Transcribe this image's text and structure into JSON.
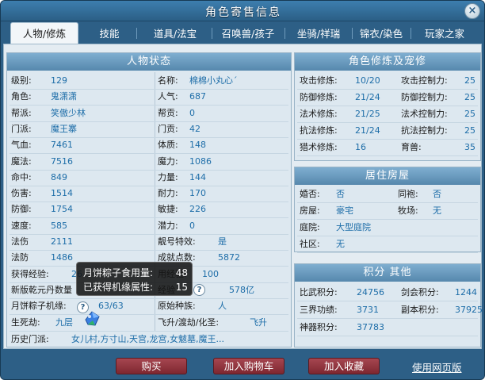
{
  "window": {
    "title": "角色寄售信息",
    "close": "×"
  },
  "tabs": [
    "人物/修炼",
    "技能",
    "道具/法宝",
    "召唤兽/孩子",
    "坐骑/祥瑞",
    "锦衣/染色",
    "玩家之家"
  ],
  "status": {
    "title": "人物状态",
    "left": [
      {
        "k": "级别:",
        "v": "129"
      },
      {
        "k": "角色:",
        "v": "鬼潇潇"
      },
      {
        "k": "帮派:",
        "v": "笑傲少林"
      },
      {
        "k": "门派:",
        "v": "魔王寨"
      },
      {
        "k": "气血:",
        "v": "7461"
      },
      {
        "k": "魔法:",
        "v": "7516"
      },
      {
        "k": "命中:",
        "v": "849"
      },
      {
        "k": "伤害:",
        "v": "1514"
      },
      {
        "k": "防御:",
        "v": "1754"
      },
      {
        "k": "速度:",
        "v": "585"
      },
      {
        "k": "法伤",
        "v": "2111"
      },
      {
        "k": "法防",
        "v": "1486"
      },
      {
        "k": "获得经验:",
        "v": "26"
      },
      {
        "k": "新版乾元丹数量",
        "v": ""
      },
      {
        "k": "月饼粽子机缘:",
        "v": "63/63"
      },
      {
        "k": "生死劫:",
        "v": "九层"
      }
    ],
    "right": [
      {
        "k": "名称:",
        "v": "棉棉小丸心´"
      },
      {
        "k": "人气:",
        "v": "687"
      },
      {
        "k": "帮贡:",
        "v": "0"
      },
      {
        "k": "门贡:",
        "v": "42"
      },
      {
        "k": "体质:",
        "v": "148"
      },
      {
        "k": "魔力:",
        "v": "1086"
      },
      {
        "k": "力量:",
        "v": "144"
      },
      {
        "k": "耐力:",
        "v": "170"
      },
      {
        "k": "敏捷:",
        "v": "226"
      },
      {
        "k": "潜力:",
        "v": "0"
      },
      {
        "k": "靓号特效:",
        "v": "是"
      },
      {
        "k": "成就点数:",
        "v": "5872"
      },
      {
        "k": "用经验:",
        "v": "100"
      },
      {
        "k": "经验",
        "v": "578亿"
      },
      {
        "k": "原始种族:",
        "v": "人"
      },
      {
        "k": "飞升/渡劫/化圣:",
        "v": "飞升"
      }
    ],
    "history_label": "历史门派:",
    "history_value": "女儿村,方寸山,天宫,龙宫,女魃墓,魔王..."
  },
  "cultivation": {
    "title": "角色修炼及宠修",
    "rows": [
      {
        "k1": "攻击修炼:",
        "v1": "10/20",
        "k2": "攻击控制力:",
        "v2": "25"
      },
      {
        "k1": "防御修炼:",
        "v1": "21/24",
        "k2": "防御控制力:",
        "v2": "25"
      },
      {
        "k1": "法术修炼:",
        "v1": "21/25",
        "k2": "法术控制力:",
        "v2": "25"
      },
      {
        "k1": "抗法修炼:",
        "v1": "21/24",
        "k2": "抗法控制力:",
        "v2": "25"
      },
      {
        "k1": "猎术修炼:",
        "v1": "16",
        "k2": "育兽:",
        "v2": "35"
      }
    ]
  },
  "housing": {
    "title": "居住房屋",
    "rows": [
      {
        "k1": "婚否:",
        "v1": "否",
        "k2": "同袍:",
        "v2": "否"
      },
      {
        "k1": "房屋:",
        "v1": "豪宅",
        "k2": "牧场:",
        "v2": "无"
      },
      {
        "k1": "庭院:",
        "v1": "大型庭院",
        "k2": "",
        "v2": ""
      },
      {
        "k1": "社区:",
        "v1": "无",
        "k2": "",
        "v2": ""
      }
    ]
  },
  "points": {
    "title": "积分 其他",
    "rows": [
      {
        "k1": "比武积分:",
        "v1": "24756",
        "k2": "剑会积分:",
        "v2": "1244"
      },
      {
        "k1": "三界功绩:",
        "v1": "3731",
        "k2": "副本积分:",
        "v2": "37925"
      },
      {
        "k1": "神器积分:",
        "v1": "37783",
        "k2": "",
        "v2": ""
      }
    ]
  },
  "tooltip": {
    "line1_label": "月饼粽子食用量:",
    "line1_value": "48",
    "line2_label": "已获得机缘属性:",
    "line2_value": "15"
  },
  "help_glyph": "?",
  "actions": {
    "buy": "购买",
    "cart": "加入购物车",
    "favorite": "加入收藏",
    "web": "使用网页版"
  }
}
